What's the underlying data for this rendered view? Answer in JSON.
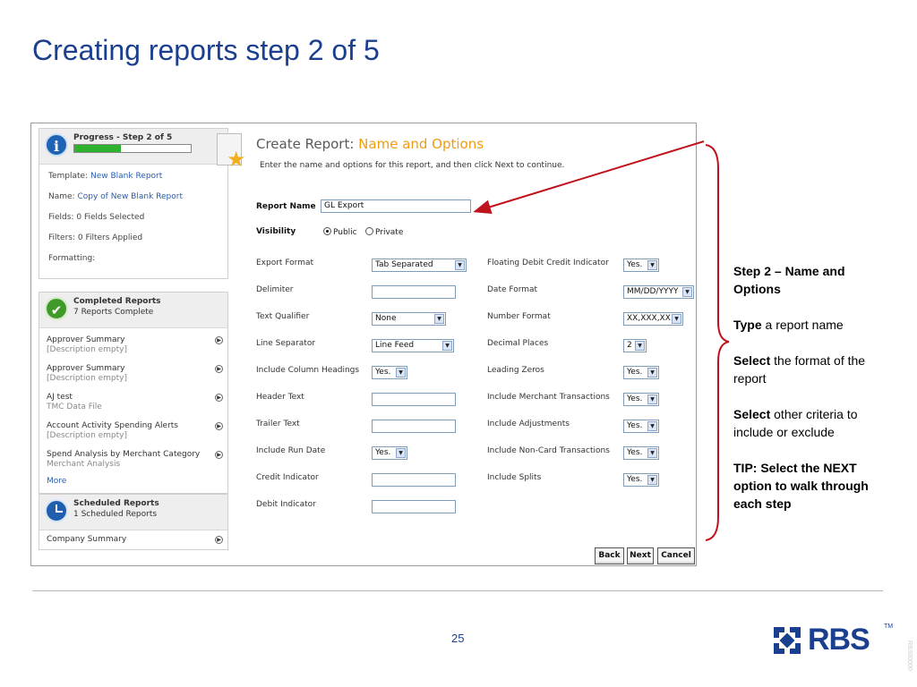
{
  "slide": {
    "title": "Creating reports step 2 of 5",
    "page_number": "25",
    "vertical_code": "RBS00000",
    "logo_text": "RBS",
    "logo_tm": "TM"
  },
  "colors": {
    "title_blue": "#1b3f8f",
    "accent_orange": "#f29b12",
    "arrow_red": "#c0121c",
    "progress_green": "#2fb32f"
  },
  "sidebar": {
    "progress": {
      "title": "Progress - Step 2 of 5",
      "fraction": 0.4,
      "rows": [
        {
          "label": "Template:",
          "value": "New Blank Report"
        },
        {
          "label": "Name:",
          "value": "Copy of New Blank Report"
        },
        {
          "label": "Fields: 0 Fields Selected",
          "value": ""
        },
        {
          "label": "Filters: 0 Filters Applied",
          "value": ""
        },
        {
          "label": "Formatting:",
          "value": ""
        }
      ]
    },
    "completed": {
      "title": "Completed Reports",
      "subtitle": "7 Reports Complete",
      "items": [
        {
          "title": "Approver Summary",
          "desc": "[Description empty]"
        },
        {
          "title": "Approver Summary",
          "desc": "[Description empty]"
        },
        {
          "title": "AJ test",
          "desc": "TMC Data File"
        },
        {
          "title": "Account Activity Spending Alerts",
          "desc": "[Description empty]"
        },
        {
          "title": "Spend Analysis by Merchant Category",
          "desc": "Merchant Analysis"
        }
      ],
      "more": "More"
    },
    "scheduled": {
      "title": "Scheduled Reports",
      "subtitle": "1 Scheduled Reports",
      "items": [
        {
          "title": "Company Summary"
        }
      ]
    }
  },
  "form": {
    "title_prefix": "Create Report:",
    "title_accent": "Name and Options",
    "subtitle": "Enter the name and options for this report, and then click Next to continue.",
    "report_name_label": "Report Name",
    "report_name_value": "GL Export",
    "visibility_label": "Visibility",
    "visibility_options": [
      "Public",
      "Private"
    ],
    "visibility_selected": "Public",
    "left_fields": [
      {
        "label": "Export Format",
        "value": "Tab Separated",
        "kind": "select"
      },
      {
        "label": "Delimiter",
        "value": "",
        "kind": "text"
      },
      {
        "label": "Text Qualifier",
        "value": "None",
        "kind": "select"
      },
      {
        "label": "Line Separator",
        "value": "Line Feed",
        "kind": "select"
      },
      {
        "label": "Include Column Headings",
        "value": "Yes.",
        "kind": "select"
      },
      {
        "label": "Header Text",
        "value": "",
        "kind": "text"
      },
      {
        "label": "Trailer Text",
        "value": "",
        "kind": "text"
      },
      {
        "label": "Include Run Date",
        "value": "Yes.",
        "kind": "select"
      },
      {
        "label": "Credit Indicator",
        "value": "",
        "kind": "text"
      },
      {
        "label": "Debit Indicator",
        "value": "",
        "kind": "text"
      }
    ],
    "right_fields": [
      {
        "label": "Floating Debit Credit Indicator",
        "value": "Yes."
      },
      {
        "label": "Date Format",
        "value": "MM/DD/YYYY"
      },
      {
        "label": "Number Format",
        "value": "XX,XXX,XX"
      },
      {
        "label": "Decimal Places",
        "value": "2"
      },
      {
        "label": "Leading Zeros",
        "value": "Yes."
      },
      {
        "label": "Include Merchant Transactions",
        "value": "Yes."
      },
      {
        "label": "Include Adjustments",
        "value": "Yes."
      },
      {
        "label": "Include Non-Card Transactions",
        "value": "Yes."
      },
      {
        "label": "Include Splits",
        "value": "Yes."
      }
    ],
    "buttons": {
      "back": "Back",
      "next": "Next",
      "cancel": "Cancel"
    }
  },
  "annotation": {
    "step_heading": "Step 2 – Name and Options",
    "type_bold": "Type",
    "type_rest": " a report name",
    "select1_bold": "Select",
    "select1_rest": " the format of the report",
    "select2_bold": "Select",
    "select2_rest": " other criteria to include or exclude",
    "tip": "TIP: Select the NEXT option to walk through each step"
  }
}
